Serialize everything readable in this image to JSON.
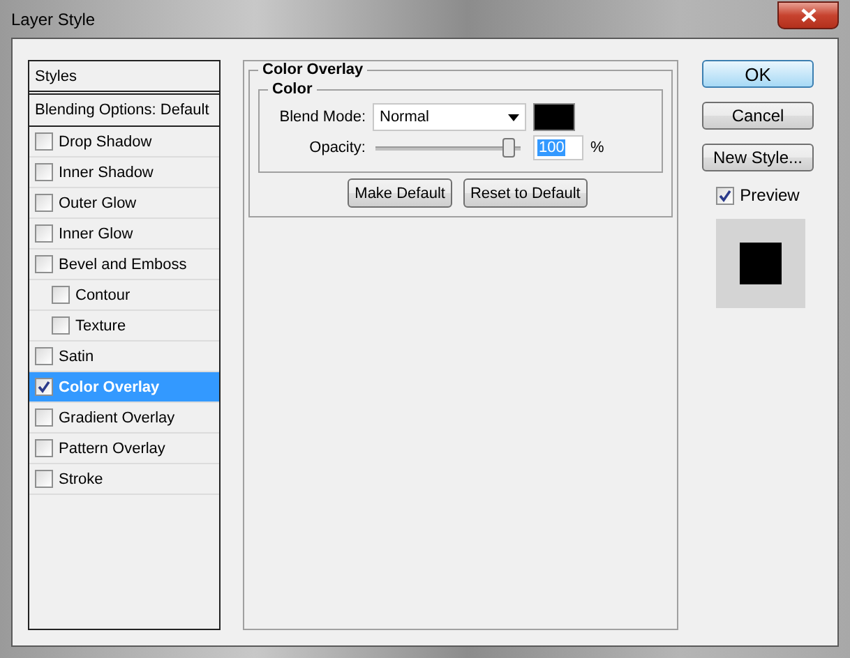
{
  "window": {
    "title": "Layer Style"
  },
  "styles_list": {
    "header": "Styles",
    "blending_options": "Blending Options: Default",
    "items": [
      {
        "label": "Drop Shadow",
        "checked": false,
        "selected": false
      },
      {
        "label": "Inner Shadow",
        "checked": false,
        "selected": false
      },
      {
        "label": "Outer Glow",
        "checked": false,
        "selected": false
      },
      {
        "label": "Inner Glow",
        "checked": false,
        "selected": false
      },
      {
        "label": "Bevel and Emboss",
        "checked": false,
        "selected": false,
        "children": [
          {
            "label": "Contour",
            "checked": false,
            "selected": false
          },
          {
            "label": "Texture",
            "checked": false,
            "selected": false
          }
        ]
      },
      {
        "label": "Satin",
        "checked": false,
        "selected": false
      },
      {
        "label": "Color Overlay",
        "checked": true,
        "selected": true
      },
      {
        "label": "Gradient Overlay",
        "checked": false,
        "selected": false
      },
      {
        "label": "Pattern Overlay",
        "checked": false,
        "selected": false
      },
      {
        "label": "Stroke",
        "checked": false,
        "selected": false
      }
    ]
  },
  "color_overlay": {
    "title": "Color Overlay",
    "group": "Color",
    "blend_mode": {
      "label": "Blend Mode:",
      "value": "Normal",
      "color": "#000000"
    },
    "opacity": {
      "label": "Opacity:",
      "level": 0.95,
      "value": "100",
      "unit": "%"
    },
    "buttons": [
      "Make Default",
      "Reset to Default"
    ]
  },
  "actions": [
    {
      "label": "OK",
      "default": true
    },
    {
      "label": "Cancel",
      "default": false
    },
    {
      "label": "New Style...",
      "default": false
    }
  ],
  "preview": {
    "label": "Preview",
    "checked": true
  }
}
